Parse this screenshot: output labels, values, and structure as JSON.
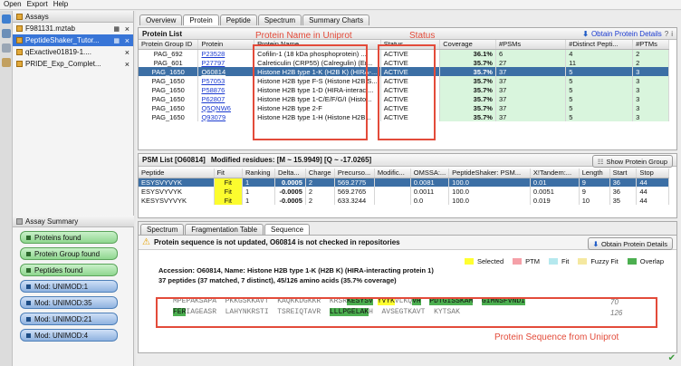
{
  "menu": [
    "Open",
    "Export",
    "Help"
  ],
  "assays": {
    "title": "Assays",
    "items": [
      {
        "name": "F981131.mztab",
        "selected": false
      },
      {
        "name": "PeptideShaker_Tutor...",
        "selected": true
      },
      {
        "name": "qExactive01819-1....",
        "selected": false
      },
      {
        "name": "PRIDE_Exp_Complet...",
        "selected": false
      }
    ]
  },
  "summary": {
    "title": "Assay Summary",
    "items": [
      {
        "label": "Proteins found",
        "kind": "green"
      },
      {
        "label": "Protein Group found",
        "kind": "green"
      },
      {
        "label": "Peptides found",
        "kind": "green"
      },
      {
        "label": "Mod: UNIMOD:1",
        "kind": "blue"
      },
      {
        "label": "Mod: UNIMOD:35",
        "kind": "blue"
      },
      {
        "label": "Mod: UNIMOD:21",
        "kind": "blue"
      },
      {
        "label": "Mod: UNIMOD:4",
        "kind": "blue"
      }
    ]
  },
  "main_tabs": [
    "Overview",
    "Protein",
    "Peptide",
    "Spectrum",
    "Summary Charts"
  ],
  "protein_list": {
    "title": "Protein List",
    "obtain_btn": "Obtain Protein Details",
    "columns": [
      "Protein Group ID",
      "Protein",
      "Protein Name",
      "Status",
      "Coverage",
      "#PSMs",
      "#Distinct Pepti...",
      "#PTMs"
    ],
    "rows": [
      [
        "PAG_692",
        "P23528",
        "Cofilin-1 (18 kDa phosphoprotein) ...",
        "ACTIVE",
        "36.1%",
        "6",
        "4",
        "2"
      ],
      [
        "PAG_601",
        "P27797",
        "Calreticulin (CRP55) (Calregulin) (Er...",
        "ACTIVE",
        "35.7%",
        "27",
        "11",
        "2"
      ],
      [
        "PAG_1650",
        "O60814",
        "Histone H2B type 1-K (H2B K) (HIRA-...",
        "ACTIVE",
        "35.7%",
        "37",
        "5",
        "3"
      ],
      [
        "PAG_1650",
        "P57053",
        "Histone H2B type F-S (Histone H2B.S...",
        "ACTIVE",
        "35.7%",
        "37",
        "5",
        "3"
      ],
      [
        "PAG_1650",
        "P58876",
        "Histone H2B type 1-D (HIRA-interact...",
        "ACTIVE",
        "35.7%",
        "37",
        "5",
        "3"
      ],
      [
        "PAG_1650",
        "P62807",
        "Histone H2B type 1-C/E/F/G/I (Histo...",
        "ACTIVE",
        "35.7%",
        "37",
        "5",
        "3"
      ],
      [
        "PAG_1650",
        "Q5QNW6",
        "Histone H2B type 2-F",
        "ACTIVE",
        "35.7%",
        "37",
        "5",
        "3"
      ],
      [
        "PAG_1650",
        "Q93079",
        "Histone H2B type 1-H (Histone H2B...",
        "ACTIVE",
        "35.7%",
        "37",
        "5",
        "3"
      ]
    ],
    "selected_row": 2
  },
  "annotations": {
    "name_label": "Protein Name in Uniprot",
    "status_label": "Status",
    "seq_label": "Protein Sequence from Uniprot"
  },
  "psm": {
    "title": "PSM List [O60814]",
    "mods": "Modified residues: [M ~ 15.9949] [Q ~ -17.0265]",
    "show_btn": "Show Protein Group",
    "columns": [
      "Peptide",
      "Fit",
      "Ranking",
      "Delta...",
      "Charge",
      "Precurso...",
      "Modific...",
      "OMSSA:...",
      "PeptideShaker: PSM...",
      "X!Tandem:...",
      "Length",
      "Start",
      "Stop"
    ],
    "rows": [
      [
        "ESYSVYVYK",
        "Fit",
        "1",
        "0.0005",
        "2",
        "569.2775",
        "",
        "0.0081",
        "100.0",
        "0.01",
        "9",
        "36",
        "44"
      ],
      [
        "ESYSVYVYK",
        "Fit",
        "1",
        "-0.0005",
        "2",
        "569.2765",
        "",
        "0.0011",
        "100.0",
        "0.0051",
        "9",
        "36",
        "44"
      ],
      [
        "KESYSVYVYK",
        "Fit",
        "1",
        "-0.0005",
        "2",
        "633.3244",
        "",
        "0.0",
        "100.0",
        "0.019",
        "10",
        "35",
        "44"
      ]
    ],
    "selected_row": 0
  },
  "detail_tabs": [
    "Spectrum",
    "Fragmentation Table",
    "Sequence"
  ],
  "sequence": {
    "warning": "Protein sequence is not updated, O60814 is not checked in repositories",
    "obtain_btn": "Obtain Protein Details",
    "legend": [
      {
        "label": "Selected",
        "color": "#ffff30"
      },
      {
        "label": "PTM",
        "color": "#f5a0a8"
      },
      {
        "label": "Fit",
        "color": "#b5e8ee"
      },
      {
        "label": "Fuzzy Fit",
        "color": "#f5e8a0"
      },
      {
        "label": "Overlap",
        "color": "#4caf50"
      }
    ],
    "accession": "Accession: O60814, Name: Histone H2B type 1-K (H2B K) (HIRA-interacting protein 1)",
    "summary": "37 peptides (37 matched, 7 distinct), 45/126 amino acids (35.7% coverage)",
    "line1_end": "70",
    "line2_end": "126"
  }
}
